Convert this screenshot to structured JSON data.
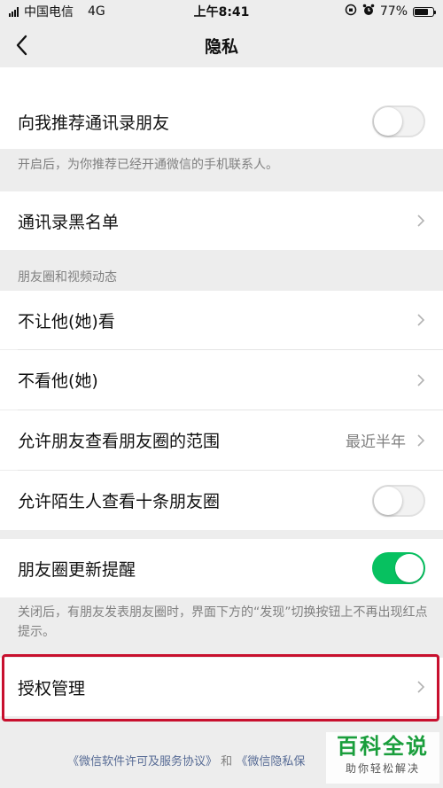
{
  "status": {
    "carrier": "中国电信",
    "network": "4G",
    "time": "上午8:41",
    "battery": "77%",
    "battery_level": 0.77
  },
  "nav": {
    "title": "隐私",
    "back_icon": "chevron-left-icon"
  },
  "rows": {
    "recommend_contacts": {
      "label": "向我推荐通讯录朋友",
      "enabled": false
    },
    "recommend_note": "开启后，为你推荐已经开通微信的手机联系人。",
    "blacklist": {
      "label": "通讯录黑名单"
    },
    "moments_section": "朋友圈和视频动态",
    "hide_from": {
      "label": "不让他(她)看"
    },
    "dont_see": {
      "label": "不看他(她)"
    },
    "moments_range": {
      "label": "允许朋友查看朋友圈的范围",
      "value": "最近半年"
    },
    "stranger_view": {
      "label": "允许陌生人查看十条朋友圈",
      "enabled": false
    },
    "moments_reminder": {
      "label": "朋友圈更新提醒",
      "enabled": true
    },
    "reminder_note": "关闭后，有朋友发表朋友圈时，界面下方的“发现”切换按钮上不再出现红点提示。",
    "authorization": {
      "label": "授权管理"
    }
  },
  "footer": {
    "license_link": "《微信软件许可及服务协议》",
    "and": "和",
    "privacy_link": "《微信隐私保"
  },
  "watermark": {
    "title": "百科全说",
    "subtitle": "助你轻松解决"
  },
  "colors": {
    "accent_green": "#07c160",
    "highlight_red": "#c8102e",
    "link_blue": "#576b95"
  }
}
